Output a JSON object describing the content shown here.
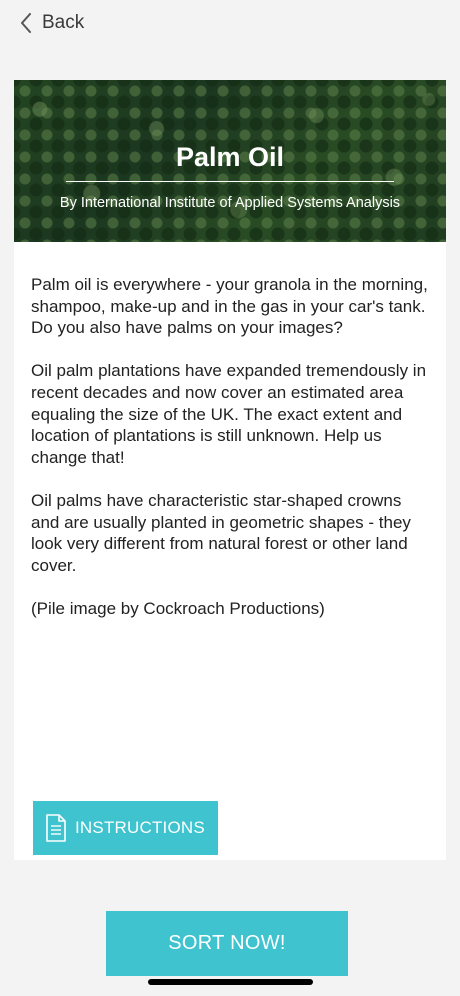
{
  "nav": {
    "back_label": "Back"
  },
  "banner": {
    "title": "Palm Oil",
    "subtitle": "By International Institute of Applied Systems Analysis"
  },
  "description": {
    "paragraphs": [
      "Palm oil is everywhere - your granola in the morning, shampoo, make-up and in the gas in your car's tank. Do you also have palms on your images?",
      "Oil palm plantations have expanded tremendously in recent decades and now cover an estimated area equaling the size of the UK. The exact extent and location of plantations is still unknown. Help us change that!",
      "Oil palms have characteristic star-shaped crowns and are usually planted in geometric shapes - they look very different from natural forest or other land cover.",
      "(Pile image by Cockroach Productions)"
    ]
  },
  "buttons": {
    "instructions_label": "INSTRUCTIONS",
    "sort_label": "SORT NOW!"
  },
  "colors": {
    "accent": "#3ec3cf",
    "background": "#f3f3f4",
    "card": "#ffffff"
  },
  "icons": {
    "back": "chevron-left-icon",
    "instructions": "document-icon"
  }
}
